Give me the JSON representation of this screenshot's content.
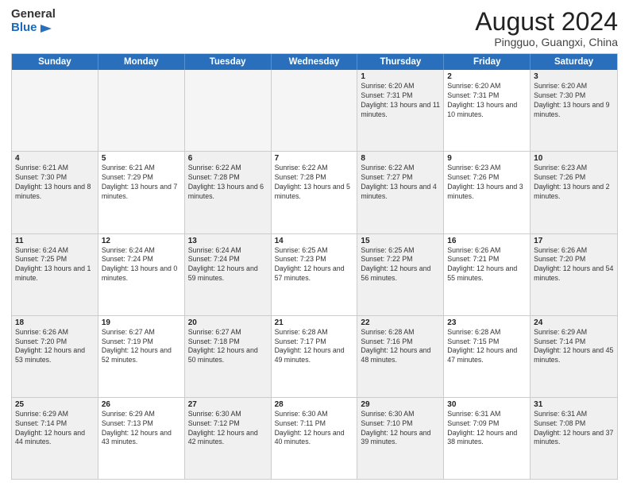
{
  "header": {
    "logo_general": "General",
    "logo_blue": "Blue",
    "month_year": "August 2024",
    "location": "Pingguo, Guangxi, China"
  },
  "calendar": {
    "days": [
      "Sunday",
      "Monday",
      "Tuesday",
      "Wednesday",
      "Thursday",
      "Friday",
      "Saturday"
    ],
    "rows": [
      [
        {
          "day": "",
          "text": "",
          "empty": true
        },
        {
          "day": "",
          "text": "",
          "empty": true
        },
        {
          "day": "",
          "text": "",
          "empty": true
        },
        {
          "day": "",
          "text": "",
          "empty": true
        },
        {
          "day": "1",
          "text": "Sunrise: 6:20 AM\nSunset: 7:31 PM\nDaylight: 13 hours and 11 minutes."
        },
        {
          "day": "2",
          "text": "Sunrise: 6:20 AM\nSunset: 7:31 PM\nDaylight: 13 hours and 10 minutes."
        },
        {
          "day": "3",
          "text": "Sunrise: 6:20 AM\nSunset: 7:30 PM\nDaylight: 13 hours and 9 minutes."
        }
      ],
      [
        {
          "day": "4",
          "text": "Sunrise: 6:21 AM\nSunset: 7:30 PM\nDaylight: 13 hours and 8 minutes."
        },
        {
          "day": "5",
          "text": "Sunrise: 6:21 AM\nSunset: 7:29 PM\nDaylight: 13 hours and 7 minutes."
        },
        {
          "day": "6",
          "text": "Sunrise: 6:22 AM\nSunset: 7:28 PM\nDaylight: 13 hours and 6 minutes."
        },
        {
          "day": "7",
          "text": "Sunrise: 6:22 AM\nSunset: 7:28 PM\nDaylight: 13 hours and 5 minutes."
        },
        {
          "day": "8",
          "text": "Sunrise: 6:22 AM\nSunset: 7:27 PM\nDaylight: 13 hours and 4 minutes."
        },
        {
          "day": "9",
          "text": "Sunrise: 6:23 AM\nSunset: 7:26 PM\nDaylight: 13 hours and 3 minutes."
        },
        {
          "day": "10",
          "text": "Sunrise: 6:23 AM\nSunset: 7:26 PM\nDaylight: 13 hours and 2 minutes."
        }
      ],
      [
        {
          "day": "11",
          "text": "Sunrise: 6:24 AM\nSunset: 7:25 PM\nDaylight: 13 hours and 1 minute."
        },
        {
          "day": "12",
          "text": "Sunrise: 6:24 AM\nSunset: 7:24 PM\nDaylight: 13 hours and 0 minutes."
        },
        {
          "day": "13",
          "text": "Sunrise: 6:24 AM\nSunset: 7:24 PM\nDaylight: 12 hours and 59 minutes."
        },
        {
          "day": "14",
          "text": "Sunrise: 6:25 AM\nSunset: 7:23 PM\nDaylight: 12 hours and 57 minutes."
        },
        {
          "day": "15",
          "text": "Sunrise: 6:25 AM\nSunset: 7:22 PM\nDaylight: 12 hours and 56 minutes."
        },
        {
          "day": "16",
          "text": "Sunrise: 6:26 AM\nSunset: 7:21 PM\nDaylight: 12 hours and 55 minutes."
        },
        {
          "day": "17",
          "text": "Sunrise: 6:26 AM\nSunset: 7:20 PM\nDaylight: 12 hours and 54 minutes."
        }
      ],
      [
        {
          "day": "18",
          "text": "Sunrise: 6:26 AM\nSunset: 7:20 PM\nDaylight: 12 hours and 53 minutes."
        },
        {
          "day": "19",
          "text": "Sunrise: 6:27 AM\nSunset: 7:19 PM\nDaylight: 12 hours and 52 minutes."
        },
        {
          "day": "20",
          "text": "Sunrise: 6:27 AM\nSunset: 7:18 PM\nDaylight: 12 hours and 50 minutes."
        },
        {
          "day": "21",
          "text": "Sunrise: 6:28 AM\nSunset: 7:17 PM\nDaylight: 12 hours and 49 minutes."
        },
        {
          "day": "22",
          "text": "Sunrise: 6:28 AM\nSunset: 7:16 PM\nDaylight: 12 hours and 48 minutes."
        },
        {
          "day": "23",
          "text": "Sunrise: 6:28 AM\nSunset: 7:15 PM\nDaylight: 12 hours and 47 minutes."
        },
        {
          "day": "24",
          "text": "Sunrise: 6:29 AM\nSunset: 7:14 PM\nDaylight: 12 hours and 45 minutes."
        }
      ],
      [
        {
          "day": "25",
          "text": "Sunrise: 6:29 AM\nSunset: 7:14 PM\nDaylight: 12 hours and 44 minutes."
        },
        {
          "day": "26",
          "text": "Sunrise: 6:29 AM\nSunset: 7:13 PM\nDaylight: 12 hours and 43 minutes."
        },
        {
          "day": "27",
          "text": "Sunrise: 6:30 AM\nSunset: 7:12 PM\nDaylight: 12 hours and 42 minutes."
        },
        {
          "day": "28",
          "text": "Sunrise: 6:30 AM\nSunset: 7:11 PM\nDaylight: 12 hours and 40 minutes."
        },
        {
          "day": "29",
          "text": "Sunrise: 6:30 AM\nSunset: 7:10 PM\nDaylight: 12 hours and 39 minutes."
        },
        {
          "day": "30",
          "text": "Sunrise: 6:31 AM\nSunset: 7:09 PM\nDaylight: 12 hours and 38 minutes."
        },
        {
          "day": "31",
          "text": "Sunrise: 6:31 AM\nSunset: 7:08 PM\nDaylight: 12 hours and 37 minutes."
        }
      ]
    ]
  }
}
